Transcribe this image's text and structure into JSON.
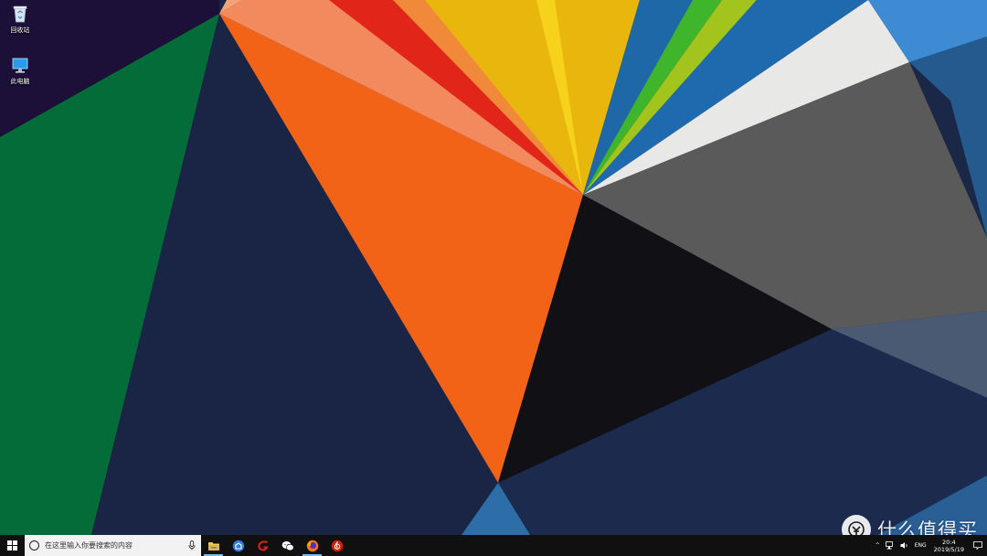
{
  "desktop": {
    "icons": [
      {
        "label": "回收站",
        "icon": "recycle-bin-icon"
      },
      {
        "label": "此电脑",
        "icon": "this-pc-icon"
      }
    ]
  },
  "taskbar": {
    "start_icon": "windows-logo-icon",
    "search": {
      "placeholder": "在这里输入你要搜索的内容",
      "icon": "cortana-ring-icon",
      "mic_icon": "microphone-icon"
    },
    "apps": [
      {
        "name": "file-explorer",
        "icon": "folder-icon",
        "color": "#f2c94c",
        "active": true
      },
      {
        "name": "browser-blue",
        "icon": "blue-browser-icon",
        "color": "#2f7de1"
      },
      {
        "name": "red-app",
        "icon": "red-swirl-icon",
        "color": "#e02020"
      },
      {
        "name": "wechat",
        "icon": "wechat-icon",
        "color": "#ffffff"
      },
      {
        "name": "firefox",
        "icon": "firefox-icon",
        "color": "#ff7a00",
        "active": true
      },
      {
        "name": "netease-music",
        "icon": "netease-music-icon",
        "color": "#d81e06"
      }
    ],
    "tray": {
      "chevron": "^",
      "language": "ENG",
      "time": "20:4",
      "date": "2019/5/19"
    }
  },
  "watermark": {
    "text": "什么值得买",
    "icon": "smzdm-logo-icon"
  },
  "colors": {
    "wallpaper_navy": "#1b2746",
    "wallpaper_orange": "#f26318",
    "wallpaper_yellow": "#eab70f",
    "wallpaper_green": "#046c39",
    "taskbar": "#101010"
  }
}
